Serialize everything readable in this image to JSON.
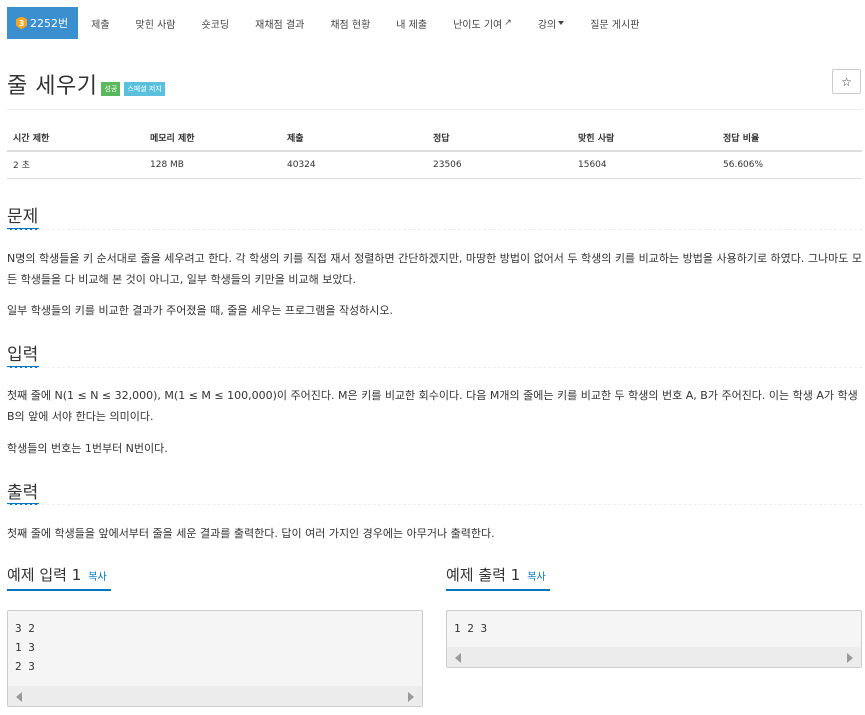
{
  "nav": {
    "active": {
      "tier": "3",
      "label": "2252번"
    },
    "items": [
      "제출",
      "맞힌 사람",
      "숏코딩",
      "재채점 결과",
      "채점 현황",
      "내 제출",
      "난이도 기여",
      "강의",
      "질문 게시판"
    ]
  },
  "problem": {
    "title": "줄 세우기",
    "labels": [
      "성공",
      "스페셜 저지"
    ],
    "star": "☆"
  },
  "stats": {
    "headers": [
      "시간 제한",
      "메모리 제한",
      "제출",
      "정답",
      "맞힌 사람",
      "정답 비율"
    ],
    "values": [
      "2 초",
      "128 MB",
      "40324",
      "23506",
      "15604",
      "56.606%"
    ]
  },
  "sections": {
    "description": {
      "heading": "문제",
      "paragraphs": [
        "N명의 학생들을 키 순서대로 줄을 세우려고 한다. 각 학생의 키를 직접 재서 정렬하면 간단하겠지만, 마땅한 방법이 없어서 두 학생의 키를 비교하는 방법을 사용하기로 하였다. 그나마도 모든 학생들을 다 비교해 본 것이 아니고, 일부 학생들의 키만을 비교해 보았다.",
        "일부 학생들의 키를 비교한 결과가 주어졌을 때, 줄을 세우는 프로그램을 작성하시오."
      ]
    },
    "input": {
      "heading": "입력",
      "paragraphs": [
        "첫째 줄에 N(1 ≤ N ≤ 32,000), M(1 ≤ M ≤ 100,000)이 주어진다. M은 키를 비교한 회수이다. 다음 M개의 줄에는 키를 비교한 두 학생의 번호 A, B가 주어진다. 이는 학생 A가 학생 B의 앞에 서야 한다는 의미이다.",
        "학생들의 번호는 1번부터 N번이다."
      ]
    },
    "output": {
      "heading": "출력",
      "paragraphs": [
        "첫째 줄에 학생들을 앞에서부터 줄을 세운 결과를 출력한다. 답이 여러 가지인 경우에는 아무거나 출력한다."
      ]
    }
  },
  "examples": {
    "input": {
      "heading": "예제 입력 1",
      "copy": "복사",
      "content": "3 2\n1 3\n2 3"
    },
    "output": {
      "heading": "예제 출력 1",
      "copy": "복사",
      "content": "1 2 3"
    }
  }
}
